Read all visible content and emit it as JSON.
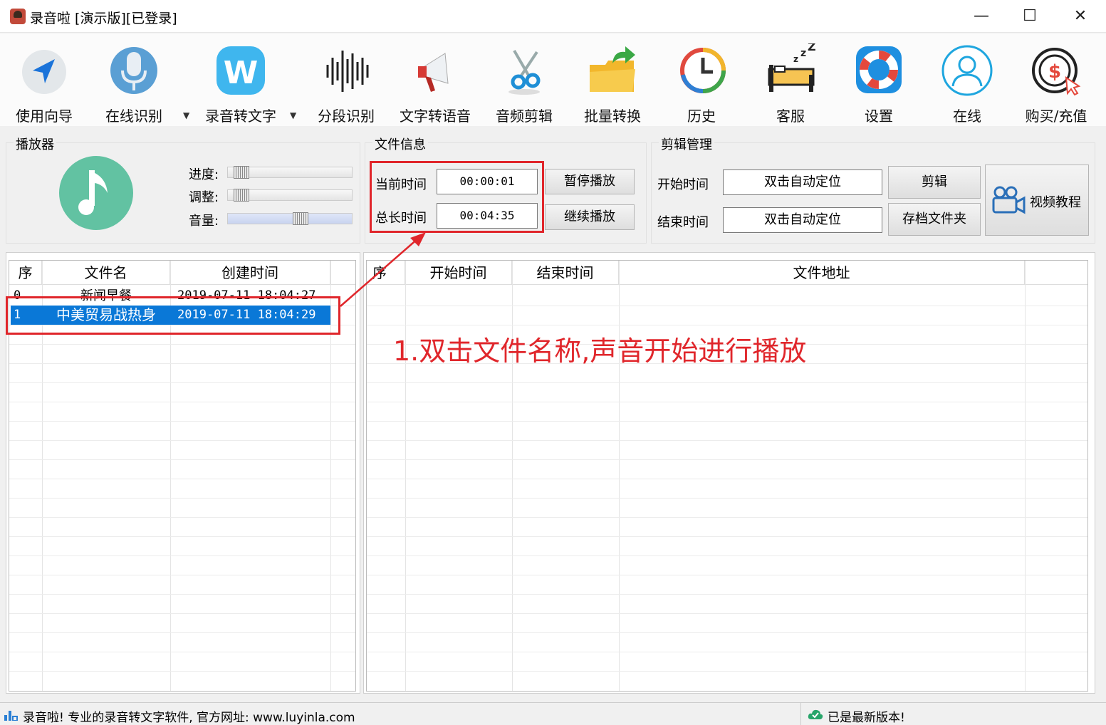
{
  "window": {
    "title": "录音啦 [演示版][已登录]",
    "minimize": "—",
    "maximize": "☐",
    "close": "✕"
  },
  "toolbar": [
    {
      "label": "使用向导",
      "icon": "navigation-arrow-icon"
    },
    {
      "label": "在线识别",
      "icon": "microphone-icon",
      "dropdown": true
    },
    {
      "label": "录音转文字",
      "icon": "w-logo-icon",
      "dropdown": true
    },
    {
      "label": "分段识别",
      "icon": "waveform-icon"
    },
    {
      "label": "文字转语音",
      "icon": "megaphone-icon"
    },
    {
      "label": "音频剪辑",
      "icon": "scissors-icon"
    },
    {
      "label": "批量转换",
      "icon": "folder-export-icon"
    },
    {
      "label": "历史",
      "icon": "history-clock-icon"
    },
    {
      "label": "客服",
      "icon": "sleeping-bed-icon"
    },
    {
      "label": "设置",
      "icon": "lifebuoy-icon"
    },
    {
      "label": "在线",
      "icon": "user-online-icon"
    },
    {
      "label": "购买/充值",
      "icon": "dollar-click-icon"
    }
  ],
  "player": {
    "title": "播放器",
    "progress_label": "进度:",
    "adjust_label": "调整:",
    "volume_label": "音量:",
    "progress": 0.05,
    "adjust": 0.05,
    "volume": 0.6
  },
  "fileinfo": {
    "title": "文件信息",
    "current_label": "当前时间",
    "current_value": "00:00:01",
    "total_label": "总长时间",
    "total_value": "00:04:35",
    "pause_btn": "暂停播放",
    "resume_btn": "继续播放"
  },
  "clip": {
    "title": "剪辑管理",
    "start_label": "开始时间",
    "end_label": "结束时间",
    "start_value": "双击自动定位",
    "end_value": "双击自动定位",
    "cut_btn": "剪辑",
    "folder_btn": "存档文件夹",
    "video_btn": "视频教程"
  },
  "filelist": {
    "headers": [
      "序",
      "文件名",
      "创建时间"
    ],
    "rows": [
      [
        "0",
        "新闻早餐",
        "2019-07-11 18:04:27"
      ],
      [
        "1",
        "中美贸易战热身",
        "2019-07-11 18:04:29"
      ]
    ],
    "selected": 1
  },
  "segments": {
    "headers": [
      "序",
      "开始时间",
      "结束时间",
      "文件地址"
    ]
  },
  "annotation": "1.双击文件名称,声音开始进行播放",
  "status": {
    "left": "录音啦! 专业的录音转文字软件, 官方网址: www.luyinla.com",
    "right": "已是最新版本!"
  },
  "colors": {
    "annotation": "#e0262b",
    "selection": "#0a78d7"
  }
}
